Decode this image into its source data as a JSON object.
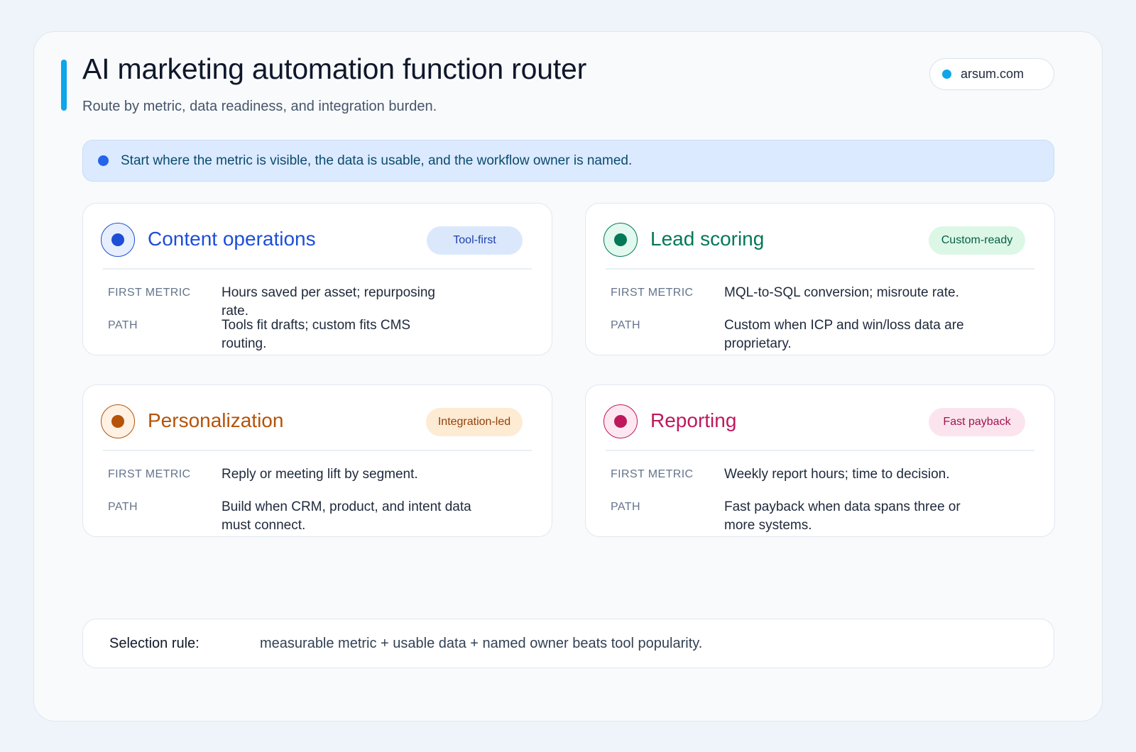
{
  "header": {
    "title": "AI marketing automation function router",
    "subtitle": "Route by metric, data readiness, and integration burden.",
    "domain": "arsum.com"
  },
  "banner": {
    "text": "Start where the metric is visible, the data is usable, and the workflow owner is named."
  },
  "labels": {
    "first_metric": "FIRST METRIC",
    "path": "PATH"
  },
  "cards": [
    {
      "title": "Content operations",
      "tag": "Tool-first",
      "first_metric": "Hours saved per asset; repurposing rate.",
      "path": "Tools fit drafts; custom fits CMS routing.",
      "color": "#1d4ed8",
      "icon_bg": "#e7efff",
      "tag_bg": "#dbe8fc",
      "tag_text": "#1e40af"
    },
    {
      "title": "Lead scoring",
      "tag": "Custom-ready",
      "first_metric": "MQL-to-SQL conversion; misroute rate.",
      "path": "Custom when ICP and win/loss data are proprietary.",
      "color": "#047857",
      "icon_bg": "#e3f8ee",
      "tag_bg": "#dcf7e6",
      "tag_text": "#065f46"
    },
    {
      "title": "Personalization",
      "tag": "Integration-led",
      "first_metric": "Reply or meeting lift by segment.",
      "path": "Build when CRM, product, and intent data must connect.",
      "color": "#b45309",
      "icon_bg": "#fff1e3",
      "tag_bg": "#fdebd3",
      "tag_text": "#92400e"
    },
    {
      "title": "Reporting",
      "tag": "Fast payback",
      "first_metric": "Weekly report hours; time to decision.",
      "path": "Fast payback when data spans three or more systems.",
      "color": "#be185d",
      "icon_bg": "#fde7f1",
      "tag_bg": "#fce4ef",
      "tag_text": "#9d174d"
    }
  ],
  "rule": {
    "label": "Selection rule:",
    "text": "measurable metric + usable data + named owner beats tool popularity."
  }
}
